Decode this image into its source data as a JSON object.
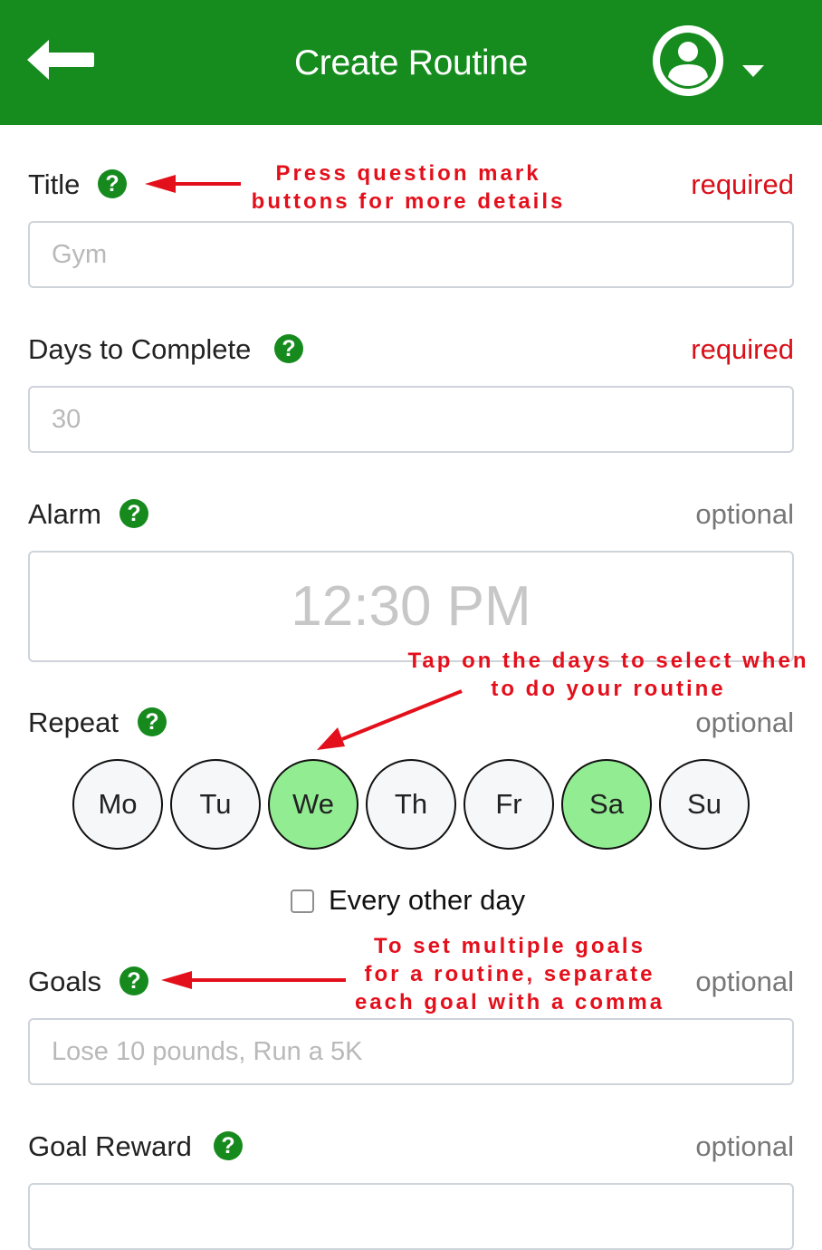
{
  "header": {
    "title": "Create Routine"
  },
  "form": {
    "title": {
      "label": "Title",
      "status": "required",
      "placeholder": "Gym"
    },
    "days_to_complete": {
      "label": "Days to Complete",
      "status": "required",
      "placeholder": "30"
    },
    "alarm": {
      "label": "Alarm",
      "status": "optional",
      "time": "12:30 PM"
    },
    "repeat": {
      "label": "Repeat",
      "status": "optional",
      "days": [
        {
          "label": "Mo",
          "selected": false
        },
        {
          "label": "Tu",
          "selected": false
        },
        {
          "label": "We",
          "selected": true
        },
        {
          "label": "Th",
          "selected": false
        },
        {
          "label": "Fr",
          "selected": false
        },
        {
          "label": "Sa",
          "selected": true
        },
        {
          "label": "Su",
          "selected": false
        }
      ],
      "every_other_day_label": "Every other day",
      "every_other_day_checked": false
    },
    "goals": {
      "label": "Goals",
      "status": "optional",
      "placeholder": "Lose 10 pounds, Run a 5K"
    },
    "goal_reward": {
      "label": "Goal Reward",
      "status": "optional"
    }
  },
  "annotations": {
    "question_mark": [
      "Press question mark",
      "buttons for more details"
    ],
    "days": [
      "Tap on the days to select when",
      "to do your routine"
    ],
    "goals": [
      "To set multiple goals",
      "for a routine, separate",
      "each goal with a comma"
    ]
  },
  "colors": {
    "header": "#168c1e",
    "help_icon": "#178a1e",
    "required": "#d9101a",
    "selected_day": "#92ec92",
    "annotation": "#e3101c"
  },
  "icons": {
    "back": "back-arrow-icon",
    "help": "question-mark-icon",
    "avatar": "user-avatar-icon",
    "dropdown": "chevron-down-icon"
  }
}
